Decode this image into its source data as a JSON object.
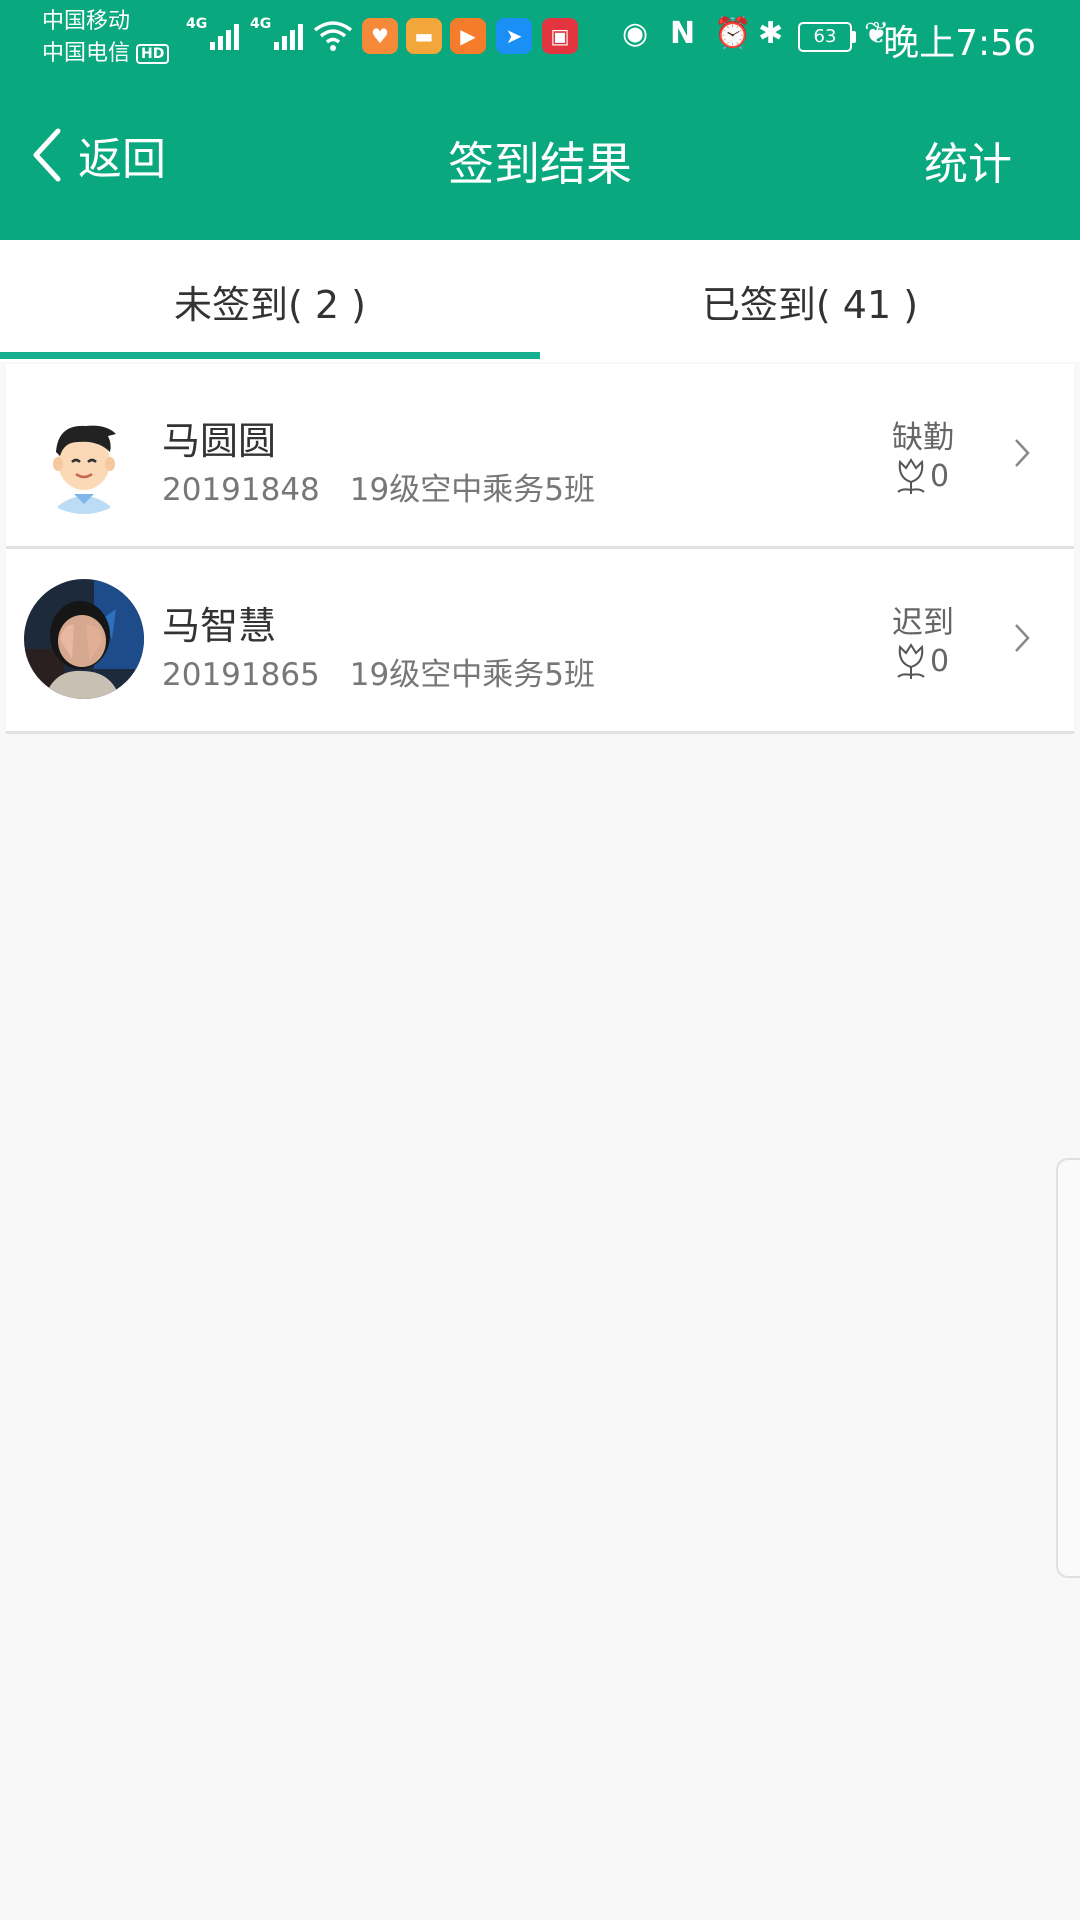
{
  "status_bar": {
    "carrier1": "中国移动",
    "carrier2": "中国电信",
    "hd": "HD",
    "net1": "4G",
    "net2": "4G",
    "battery": "63",
    "time": "晚上7:56"
  },
  "header": {
    "back_label": "返回",
    "title": "签到结果",
    "action": "统计"
  },
  "tabs": [
    {
      "label": "未签到( 2 )",
      "active": true
    },
    {
      "label": "已签到( 41 )",
      "active": false
    }
  ],
  "students": [
    {
      "name": "马圆圆",
      "id": "20191848",
      "class": "19级空中乘务5班",
      "status": "缺勤",
      "flowers": "0"
    },
    {
      "name": "马智慧",
      "id": "20191865",
      "class": "19级空中乘务5班",
      "status": "迟到",
      "flowers": "0"
    }
  ],
  "colors": {
    "primary": "#0aa87f",
    "indicator": "#14b08f",
    "background": "#f8f8f8"
  }
}
